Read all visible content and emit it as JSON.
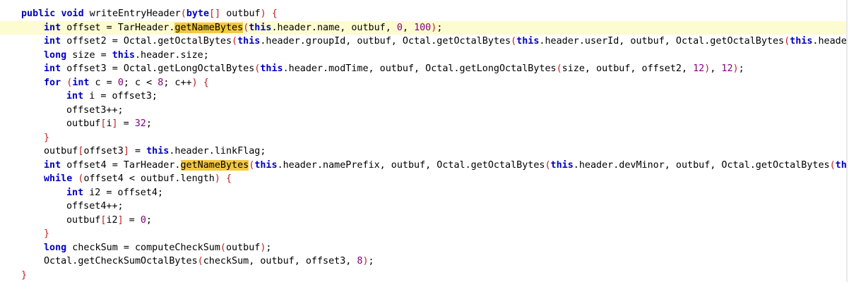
{
  "editor": {
    "colors": {
      "keyword": "#0000c0",
      "bracket": "#c02020",
      "number": "#800080",
      "current_line": "#fdfbd0",
      "occurrence": "#f5c842"
    },
    "lines": [
      {
        "indent": 0,
        "tokens": [
          {
            "t": "public",
            "c": "kw"
          },
          {
            "t": " "
          },
          {
            "t": "void",
            "c": "kw"
          },
          {
            "t": " writeEntryHeader"
          },
          {
            "t": "(",
            "c": "br"
          },
          {
            "t": "byte",
            "c": "kw"
          },
          {
            "t": "[]",
            "c": "br"
          },
          {
            "t": " outbuf"
          },
          {
            "t": ")",
            "c": "br"
          },
          {
            "t": " "
          },
          {
            "t": "{",
            "c": "br"
          }
        ]
      },
      {
        "indent": 1,
        "current": true,
        "tokens": [
          {
            "t": "int",
            "c": "kw"
          },
          {
            "t": " offset = TarHeader."
          },
          {
            "t": "getNameBytes",
            "c": "occ"
          },
          {
            "t": "(",
            "c": "br"
          },
          {
            "t": "this",
            "c": "kw"
          },
          {
            "t": ".header.name, outbuf, "
          },
          {
            "t": "0",
            "c": "num"
          },
          {
            "t": ", "
          },
          {
            "t": "100",
            "c": "num"
          },
          {
            "t": ")",
            "c": "br"
          },
          {
            "t": ";"
          }
        ]
      },
      {
        "indent": 1,
        "tokens": [
          {
            "t": "int",
            "c": "kw"
          },
          {
            "t": " offset2 = Octal.getOctalBytes"
          },
          {
            "t": "(",
            "c": "br"
          },
          {
            "t": "this",
            "c": "kw"
          },
          {
            "t": ".header.groupId, outbuf, Octal.getOctalBytes"
          },
          {
            "t": "(",
            "c": "br"
          },
          {
            "t": "this",
            "c": "kw"
          },
          {
            "t": ".header.userId, outbuf, Octal.getOctalBytes"
          },
          {
            "t": "(",
            "c": "br"
          },
          {
            "t": "this",
            "c": "kw"
          },
          {
            "t": ".header"
          }
        ]
      },
      {
        "indent": 1,
        "tokens": [
          {
            "t": "long",
            "c": "kw"
          },
          {
            "t": " size = "
          },
          {
            "t": "this",
            "c": "kw"
          },
          {
            "t": ".header.size;"
          }
        ]
      },
      {
        "indent": 1,
        "tokens": [
          {
            "t": "int",
            "c": "kw"
          },
          {
            "t": " offset3 = Octal.getLongOctalBytes"
          },
          {
            "t": "(",
            "c": "br"
          },
          {
            "t": "this",
            "c": "kw"
          },
          {
            "t": ".header.modTime, outbuf, Octal.getLongOctalBytes"
          },
          {
            "t": "(",
            "c": "br"
          },
          {
            "t": "size, outbuf, offset2, "
          },
          {
            "t": "12",
            "c": "num"
          },
          {
            "t": ")",
            "c": "br"
          },
          {
            "t": ", "
          },
          {
            "t": "12",
            "c": "num"
          },
          {
            "t": ")",
            "c": "br"
          },
          {
            "t": ";"
          }
        ]
      },
      {
        "indent": 1,
        "tokens": [
          {
            "t": "for",
            "c": "kw"
          },
          {
            "t": " "
          },
          {
            "t": "(",
            "c": "br"
          },
          {
            "t": "int",
            "c": "kw"
          },
          {
            "t": " c = "
          },
          {
            "t": "0",
            "c": "num"
          },
          {
            "t": "; c < "
          },
          {
            "t": "8",
            "c": "num"
          },
          {
            "t": "; c++"
          },
          {
            "t": ")",
            "c": "br"
          },
          {
            "t": " "
          },
          {
            "t": "{",
            "c": "br"
          }
        ]
      },
      {
        "indent": 2,
        "tokens": [
          {
            "t": "int",
            "c": "kw"
          },
          {
            "t": " i = offset3;"
          }
        ]
      },
      {
        "indent": 2,
        "tokens": [
          {
            "t": "offset3++;"
          }
        ]
      },
      {
        "indent": 2,
        "tokens": [
          {
            "t": "outbuf"
          },
          {
            "t": "[",
            "c": "br"
          },
          {
            "t": "i"
          },
          {
            "t": "]",
            "c": "br"
          },
          {
            "t": " = "
          },
          {
            "t": "32",
            "c": "num"
          },
          {
            "t": ";"
          }
        ]
      },
      {
        "indent": 1,
        "tokens": [
          {
            "t": "}",
            "c": "br"
          }
        ]
      },
      {
        "indent": 1,
        "tokens": [
          {
            "t": "outbuf"
          },
          {
            "t": "[",
            "c": "br"
          },
          {
            "t": "offset3"
          },
          {
            "t": "]",
            "c": "br"
          },
          {
            "t": " = "
          },
          {
            "t": "this",
            "c": "kw"
          },
          {
            "t": ".header.linkFlag;"
          }
        ]
      },
      {
        "indent": 1,
        "tokens": [
          {
            "t": "int",
            "c": "kw"
          },
          {
            "t": " offset4 = TarHeader."
          },
          {
            "t": "getNameBytes",
            "c": "occ"
          },
          {
            "t": "(",
            "c": "br"
          },
          {
            "t": "this",
            "c": "kw"
          },
          {
            "t": ".header.namePrefix, outbuf, Octal.getOctalBytes"
          },
          {
            "t": "(",
            "c": "br"
          },
          {
            "t": "this",
            "c": "kw"
          },
          {
            "t": ".header.devMinor, outbuf, Octal.getOctalBytes"
          },
          {
            "t": "(",
            "c": "br"
          },
          {
            "t": "thi",
            "c": "kw"
          }
        ]
      },
      {
        "indent": 1,
        "tokens": [
          {
            "t": "while",
            "c": "kw"
          },
          {
            "t": " "
          },
          {
            "t": "(",
            "c": "br"
          },
          {
            "t": "offset4 < outbuf.length"
          },
          {
            "t": ")",
            "c": "br"
          },
          {
            "t": " "
          },
          {
            "t": "{",
            "c": "br"
          }
        ]
      },
      {
        "indent": 2,
        "tokens": [
          {
            "t": "int",
            "c": "kw"
          },
          {
            "t": " i2 = offset4;"
          }
        ]
      },
      {
        "indent": 2,
        "tokens": [
          {
            "t": "offset4++;"
          }
        ]
      },
      {
        "indent": 2,
        "tokens": [
          {
            "t": "outbuf"
          },
          {
            "t": "[",
            "c": "br"
          },
          {
            "t": "i2"
          },
          {
            "t": "]",
            "c": "br"
          },
          {
            "t": " = "
          },
          {
            "t": "0",
            "c": "num"
          },
          {
            "t": ";"
          }
        ]
      },
      {
        "indent": 1,
        "tokens": [
          {
            "t": "}",
            "c": "br"
          }
        ]
      },
      {
        "indent": 1,
        "tokens": [
          {
            "t": "long",
            "c": "kw"
          },
          {
            "t": " checkSum = computeCheckSum"
          },
          {
            "t": "(",
            "c": "br"
          },
          {
            "t": "outbuf"
          },
          {
            "t": ")",
            "c": "br"
          },
          {
            "t": ";"
          }
        ]
      },
      {
        "indent": 1,
        "tokens": [
          {
            "t": "Octal.getCheckSumOctalBytes"
          },
          {
            "t": "(",
            "c": "br"
          },
          {
            "t": "checkSum, outbuf, offset3, "
          },
          {
            "t": "8",
            "c": "num"
          },
          {
            "t": ")",
            "c": "br"
          },
          {
            "t": ";"
          }
        ]
      },
      {
        "indent": 0,
        "tokens": [
          {
            "t": "}",
            "c": "br"
          }
        ]
      }
    ]
  }
}
